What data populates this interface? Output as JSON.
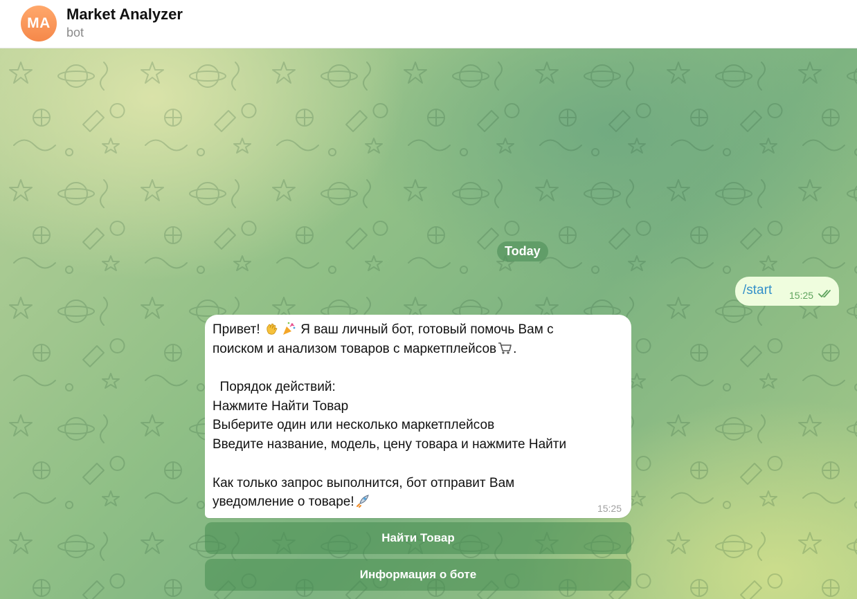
{
  "header": {
    "avatar_initials": "MA",
    "title": "Market Analyzer",
    "subtitle": "bot"
  },
  "chat": {
    "date_label": "Today",
    "outgoing": {
      "text": "/start",
      "time": "15:25",
      "status_icon": "double-check-icon"
    },
    "incoming": {
      "lines": [
        "Привет! ",
        "поиском и анализом товаров с маркетплейсов",
        "",
        "  Порядок действий:",
        "Нажмите Найти Товар",
        "Выберите один или несколько маркетплейсов",
        "Введите название, модель, цену товара и нажмите Найти",
        "",
        "Как только запрос выполнится, бот отправит Вам",
        "уведомление о товаре!"
      ],
      "line1_tail": " Я ваш личный бот, готовый помочь Вам с",
      "line2_tail": ".",
      "time": "15:25"
    },
    "keyboard": [
      {
        "label": "Найти Товар"
      },
      {
        "label": "Информация о боте"
      }
    ]
  },
  "colors": {
    "accent_out_bg": "#effdde",
    "link_blue": "#3390c9",
    "avatar_orange": "#f5884a"
  }
}
